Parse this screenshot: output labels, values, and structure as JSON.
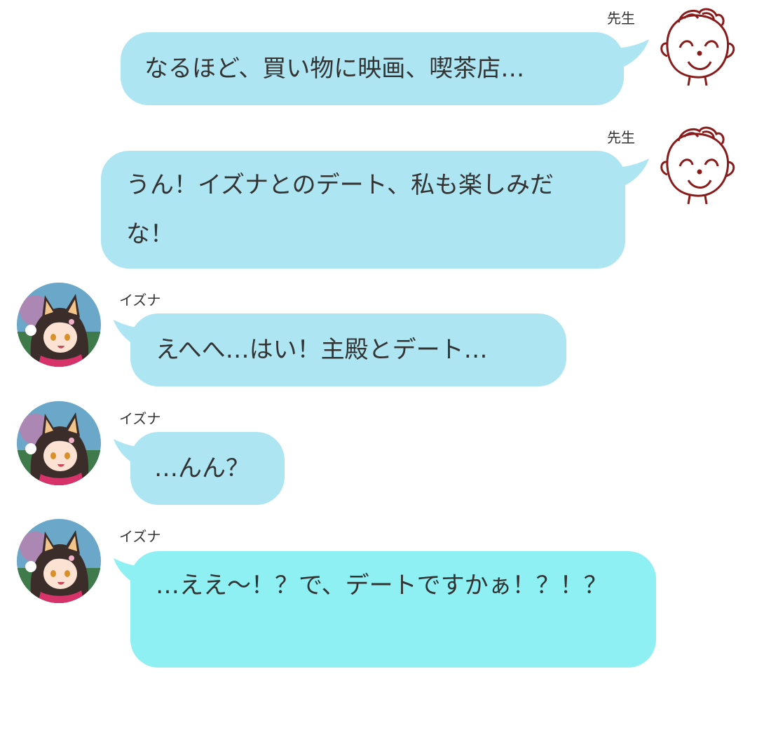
{
  "colors": {
    "bubble_blue": "#aee5f2",
    "bubble_cyan": "#8ef0f2",
    "text": "#333333",
    "sensei_icon": "#8a1b1b"
  },
  "messages": [
    {
      "sender": "先生",
      "side": "right",
      "text": "なるほど、買い物に映画、喫茶店…",
      "icon": "sensei-face-icon"
    },
    {
      "sender": "先生",
      "side": "right",
      "text": "うん！イズナとのデート、私も楽しみだな！",
      "icon": "sensei-face-icon"
    },
    {
      "sender": "イズナ",
      "side": "left",
      "text": "えへへ…はい！主殿とデート…",
      "icon": "izuna-avatar"
    },
    {
      "sender": "イズナ",
      "side": "left",
      "text": "…んん？",
      "icon": "izuna-avatar"
    },
    {
      "sender": "イズナ",
      "side": "left",
      "text": "…ええ〜！？で、デートですかぁ！？！？",
      "icon": "izuna-avatar"
    }
  ]
}
